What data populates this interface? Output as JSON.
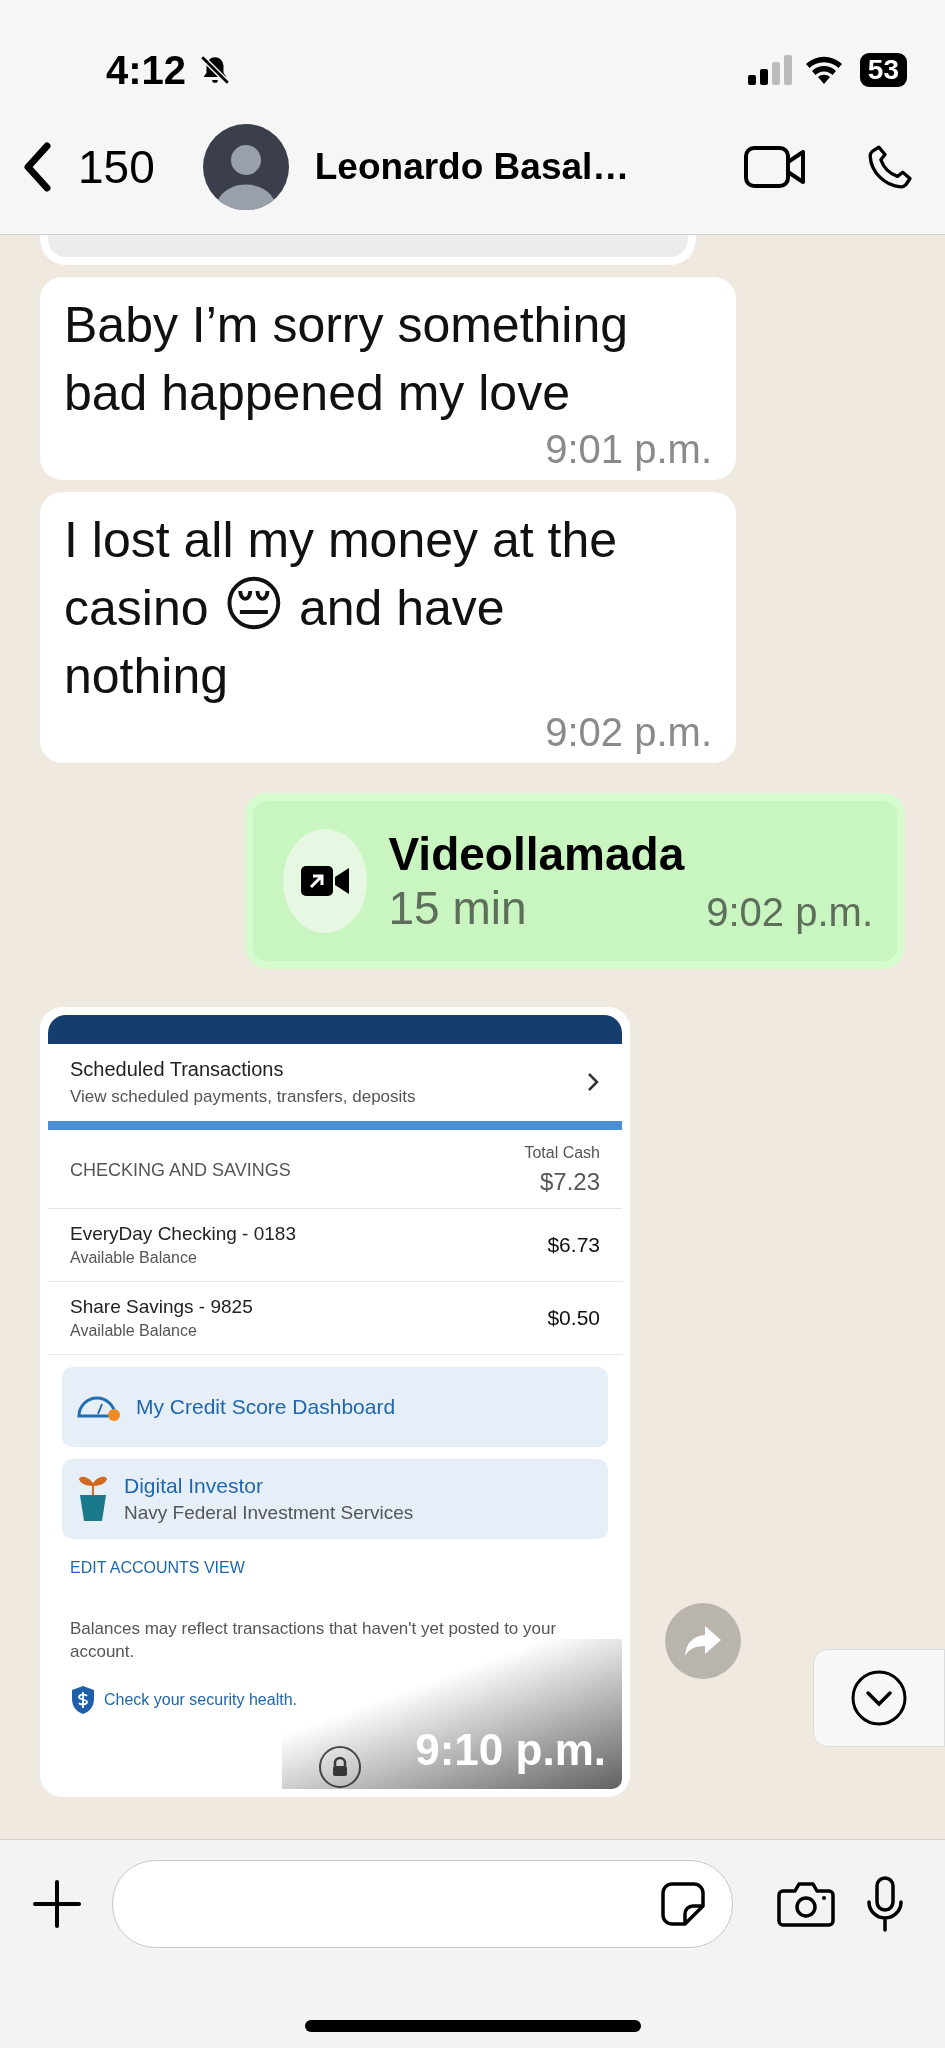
{
  "status_bar": {
    "time": "4:12",
    "battery": "53"
  },
  "header": {
    "back_count": "150",
    "contact_name": "Leonardo Basal…"
  },
  "messages": [
    {
      "kind": "text",
      "outgoing": false,
      "text": "Baby I’m sorry something bad happened my love",
      "time": "9:01 p.m."
    },
    {
      "kind": "text",
      "outgoing": false,
      "text": "I lost all my money at the casino 😔 and have nothing",
      "time": "9:02 p.m."
    },
    {
      "kind": "call",
      "outgoing": true,
      "title": "Videollamada",
      "duration": "15 min",
      "time": "9:02 p.m."
    },
    {
      "kind": "image",
      "outgoing": false,
      "time": "9:10 p.m.",
      "screenshot": {
        "scheduled": {
          "title": "Scheduled Transactions",
          "subtitle": "View scheduled payments, transfers, deposits"
        },
        "section_label": "CHECKING AND SAVINGS",
        "total_label": "Total Cash",
        "total": "$7.23",
        "accounts": [
          {
            "name": "EveryDay Checking - 0183",
            "label": "Available Balance",
            "amount": "$6.73"
          },
          {
            "name": "Share Savings - 9825",
            "label": "Available Balance",
            "amount": "$0.50"
          }
        ],
        "tiles": [
          {
            "kind": "gauge",
            "title": "My Credit Score Dashboard"
          },
          {
            "kind": "plant",
            "title": "Digital Investor",
            "subtitle": "Navy Federal Investment Services"
          }
        ],
        "edit_link": "EDIT ACCOUNTS VIEW",
        "disclaimer": "Balances may reflect transactions that haven't yet posted to your account.",
        "security_link": "Check your security health."
      }
    }
  ]
}
